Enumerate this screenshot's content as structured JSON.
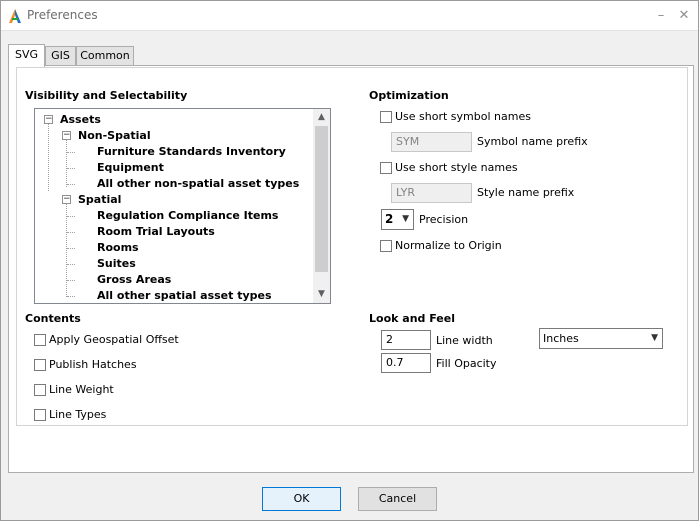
{
  "window": {
    "title": "Preferences",
    "logo_icon": "app-logo-icon",
    "minimize_glyph": "–",
    "close_glyph": "✕"
  },
  "tabs": [
    {
      "label": "SVG",
      "active": true
    },
    {
      "label": "GIS",
      "active": false
    },
    {
      "label": "Common",
      "active": false
    }
  ],
  "visibility": {
    "title": "Visibility and Selectability",
    "tree": [
      {
        "label": "Assets",
        "level": 0,
        "expanded": true
      },
      {
        "label": "Non-Spatial",
        "level": 1,
        "expanded": true
      },
      {
        "label": "Furniture Standards Inventory",
        "level": 2
      },
      {
        "label": "Equipment",
        "level": 2
      },
      {
        "label": "All other non-spatial asset types",
        "level": 2
      },
      {
        "label": "Spatial",
        "level": 1,
        "expanded": true
      },
      {
        "label": "Regulation Compliance Items",
        "level": 2
      },
      {
        "label": "Room Trial Layouts",
        "level": 2
      },
      {
        "label": "Rooms",
        "level": 2
      },
      {
        "label": "Suites",
        "level": 2
      },
      {
        "label": "Gross Areas",
        "level": 2
      },
      {
        "label": "All other spatial asset types",
        "level": 2
      }
    ],
    "expand_glyph": "−"
  },
  "optimization": {
    "title": "Optimization",
    "short_symbol_names": {
      "label": "Use short symbol names",
      "checked": false
    },
    "symbol_prefix": {
      "value": "SYM",
      "label": "Symbol name prefix"
    },
    "short_style_names": {
      "label": "Use short style names",
      "checked": false
    },
    "style_prefix": {
      "value": "LYR",
      "label": "Style name prefix"
    },
    "precision": {
      "value": "2",
      "label": "Precision"
    },
    "normalize": {
      "label": "Normalize to Origin",
      "checked": false
    }
  },
  "contents": {
    "title": "Contents",
    "options": [
      {
        "label": "Apply Geospatial Offset",
        "checked": false
      },
      {
        "label": "Publish Hatches",
        "checked": false
      },
      {
        "label": "Line Weight",
        "checked": false
      },
      {
        "label": "Line Types",
        "checked": false
      }
    ]
  },
  "look_and_feel": {
    "title": "Look and Feel",
    "line_width": {
      "value": "2",
      "label": "Line width"
    },
    "units": {
      "value": "Inches"
    },
    "fill_opacity": {
      "value": "0.7",
      "label": "Fill Opacity"
    }
  },
  "footer": {
    "ok_label": "OK",
    "cancel_label": "Cancel"
  }
}
